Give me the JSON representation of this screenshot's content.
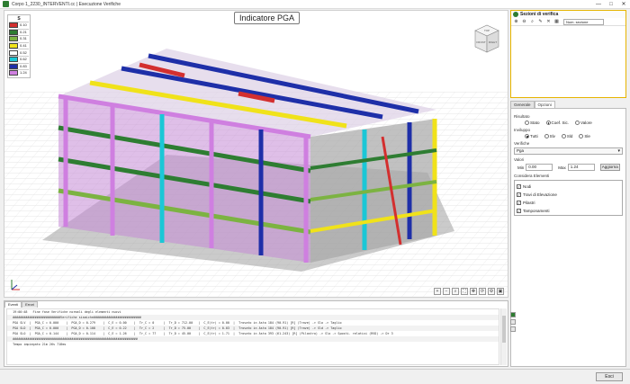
{
  "window": {
    "title": "Corpo 1_2230_INTERVENTI.cc | Esecuzione Verifiche",
    "minimize": "—",
    "maximize": "□",
    "close": "✕"
  },
  "viewport": {
    "badge": "Indicatore PGA",
    "legend": {
      "header": "S",
      "items": [
        {
          "color": "#d32f2f",
          "value": "0.10"
        },
        {
          "color": "#2e7d32",
          "value": "0.21"
        },
        {
          "color": "#7cb342",
          "value": "0.31"
        },
        {
          "color": "#f0e21a",
          "value": "0.41"
        },
        {
          "color": "#ffffff",
          "value": "0.52"
        },
        {
          "color": "#1bc7d6",
          "value": "0.62"
        },
        {
          "color": "#1e2fa8",
          "value": "0.83"
        },
        {
          "color": "#cf7fe0",
          "value": "1.24"
        }
      ]
    },
    "viewcube": {
      "top": "TOP",
      "front": "FRONT",
      "right": "RIGHT"
    },
    "axes": {
      "x": "X",
      "y": "Y",
      "z": "Z"
    },
    "toolbar_icons": [
      "zoom-in-icon",
      "zoom-out-icon",
      "zoom-window-icon",
      "zoom-extents-icon",
      "pan-icon",
      "rotate-icon",
      "settings-icon",
      "screenshot-icon"
    ],
    "toolbar_glyphs": [
      "+",
      "−",
      "⌕",
      "⛶",
      "✥",
      "⟳",
      "⚙",
      "▣"
    ]
  },
  "sections_panel": {
    "title": "Sezioni di verifica",
    "tools": [
      "⊕",
      "⊖",
      "⌕",
      "✎",
      "✕",
      "▦"
    ],
    "combo": "Num. sezione"
  },
  "options": {
    "tabs": [
      "Generale",
      "Opzioni"
    ],
    "active_tab": "Opzioni",
    "risultato_label": "Risultato",
    "risultato_options": [
      "Stato",
      "Coef. Sic.",
      "Valore"
    ],
    "risultato_selected": "Coef. Sic.",
    "inviluppo_label": "Inviluppo",
    "inviluppo_options": [
      "Tutti",
      "Slv",
      "Sld",
      "Sle"
    ],
    "inviluppo_selected": "Tutti",
    "verifiche_label": "Verifiche",
    "verifiche_value": "Pga",
    "valori_label": "Valori",
    "min_label": "Min",
    "min_value": "0.00",
    "max_label": "Max",
    "max_value": "1.24",
    "update_button": "Aggiorna",
    "elementi_label": "Considera Elementi",
    "elementi": [
      {
        "label": "Nodi",
        "checked": true
      },
      {
        "label": "Travi di Elevazione",
        "checked": true
      },
      {
        "label": "Pilastri",
        "checked": true
      },
      {
        "label": "Tamponamenti",
        "checked": true
      }
    ]
  },
  "log": {
    "tabs": [
      "Eventi",
      "Errori"
    ],
    "active_tab": "Eventi",
    "lines": [
      "  19:00:48   Fine fase Verifiche normali degli elementi nuovi",
      "  ##########################Verifiche sismiche##########################",
      "  PGA SLV  |  PGA_C = 0.000    |  PGA_D = 0.279    |  C_E = 0.00    |  Tr_C = 0     |  Tr_D = 712.00   |  C_E(tr) = 0.00  |  Trovato in Asta 184 (90-91) [R] (Trave) -> Slo -> Taglio",
      "  PGA SLD  |  PGA_C = 0.000    |  PGA_D = 0.108    |  C_E = 0.22    |  Tr_C = 2     |  Tr_D = 75.00    |  C_E(tr) = 0.03  |  Trovato in Asta 184 (90-91) [R] (Trave) -> Sld -> Taglio",
      "  PGA SLO  |  PGA_C = 0.144    |  PGA_D = 0.114    |  C_E = 1.26    |  Tr_C = 77    |  Tr_D = 45.00    |  C_E(tr) = 1.71  |  Trovato in Asta 393 (61-243) [R] (Pilastro) -> Slo -> Sposti. relativi (RVD) -> Dr 3",
      "  ####################################################################",
      "  Tempo impiegato 21m 26s 718ms"
    ]
  },
  "footer": {
    "exit_button": "Esci"
  }
}
